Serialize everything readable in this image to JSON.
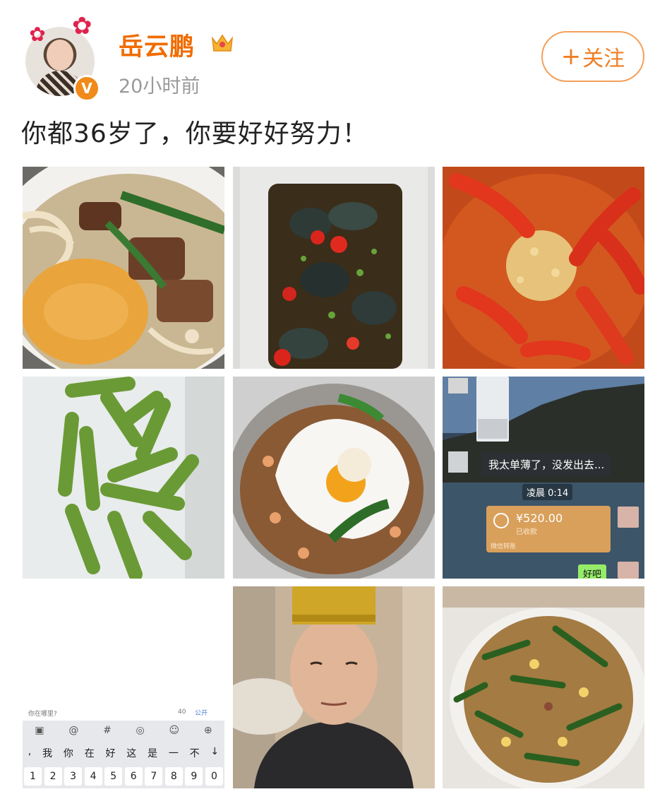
{
  "user": {
    "name": "岳云鹏",
    "timestamp": "20小时前",
    "verified_badge": "V"
  },
  "follow_button": {
    "plus": "+",
    "label": "关注"
  },
  "post": {
    "text": "你都36岁了，你要好好努力！"
  },
  "colors": {
    "accent": "#f06c00",
    "follow_border": "#f3a05a",
    "timestamp": "#9a9a9a"
  },
  "images": [
    {
      "name": "noodle-soup-photo"
    },
    {
      "name": "preserved-egg-photo"
    },
    {
      "name": "crayfish-photo"
    },
    {
      "name": "edamame-photo"
    },
    {
      "name": "fried-egg-rice-photo"
    },
    {
      "name": "chat-screenshot-photo",
      "chat_message": "我太单薄了，没发出去...",
      "chat_time": "凌晨 0:14",
      "transfer_amount": "¥520.00",
      "transfer_status": "已收款",
      "transfer_footer": "微信转账",
      "reply": "好吧"
    },
    {
      "name": "keyboard-screenshot-photo",
      "location": "你在哪里?",
      "count": "40",
      "visibility": "公开",
      "toolbar_icons": [
        "image-icon",
        "at-icon",
        "hash-icon",
        "gif-icon",
        "emoji-icon",
        "plus-icon"
      ],
      "suggestions": [
        ",",
        "我",
        "你",
        "在",
        "好",
        "这",
        "是",
        "一",
        "不",
        "↓"
      ],
      "digits": [
        "1",
        "2",
        "3",
        "4",
        "5",
        "6",
        "7",
        "8",
        "9",
        "0"
      ]
    },
    {
      "name": "selfie-photo"
    },
    {
      "name": "stir-fried-noodles-photo"
    }
  ]
}
